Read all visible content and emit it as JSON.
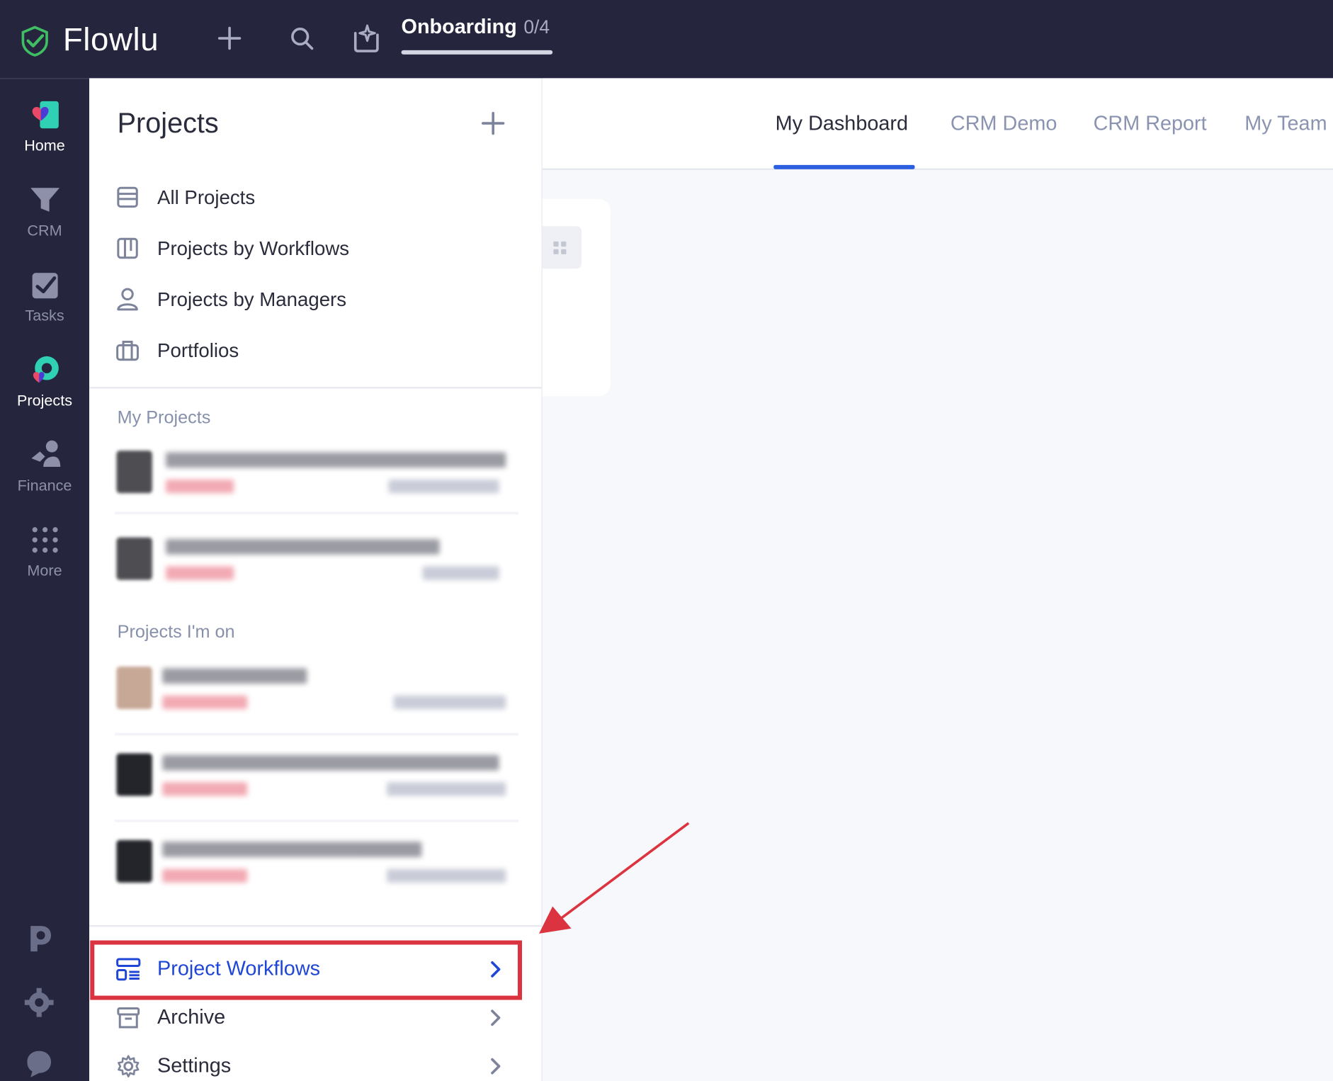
{
  "brand": {
    "name": "Flowlu"
  },
  "topbar": {
    "onboarding_label": "Onboarding",
    "onboarding_count": "0/4",
    "onboarding_progress": 0
  },
  "rail": {
    "items": [
      {
        "label": "Home",
        "icon": "home-icon",
        "active": true
      },
      {
        "label": "CRM",
        "icon": "crm-icon"
      },
      {
        "label": "Tasks",
        "icon": "tasks-icon"
      },
      {
        "label": "Projects",
        "icon": "projects-icon",
        "active": true
      },
      {
        "label": "Finance",
        "icon": "finance-icon"
      },
      {
        "label": "More",
        "icon": "more-icon"
      }
    ],
    "bottom_icons": [
      "parking-icon",
      "gear-icon",
      "chat-icon"
    ]
  },
  "panel": {
    "title": "Projects",
    "nav": [
      {
        "label": "All Projects",
        "icon": "list-icon"
      },
      {
        "label": "Projects by Workflows",
        "icon": "kanban-icon"
      },
      {
        "label": "Projects by Managers",
        "icon": "user-icon"
      },
      {
        "label": "Portfolios",
        "icon": "briefcase-icon"
      }
    ],
    "my_projects_label": "My Projects",
    "projects_im_on_label": "Projects I'm on",
    "bottom": [
      {
        "label": "Project Workflows",
        "icon": "workflows-icon",
        "highlighted": true
      },
      {
        "label": "Archive",
        "icon": "archive-icon"
      },
      {
        "label": "Settings",
        "icon": "settings-icon"
      }
    ]
  },
  "main": {
    "tabs": [
      {
        "label": "My Dashboard",
        "active": true
      },
      {
        "label": "CRM Demo"
      },
      {
        "label": "CRM Report"
      },
      {
        "label": "My Team"
      }
    ]
  },
  "colors": {
    "topbar_bg": "#25263e",
    "accent_blue": "#2c5fe0",
    "highlight_red": "#dc3340",
    "brand_green": "#3fbe63"
  }
}
